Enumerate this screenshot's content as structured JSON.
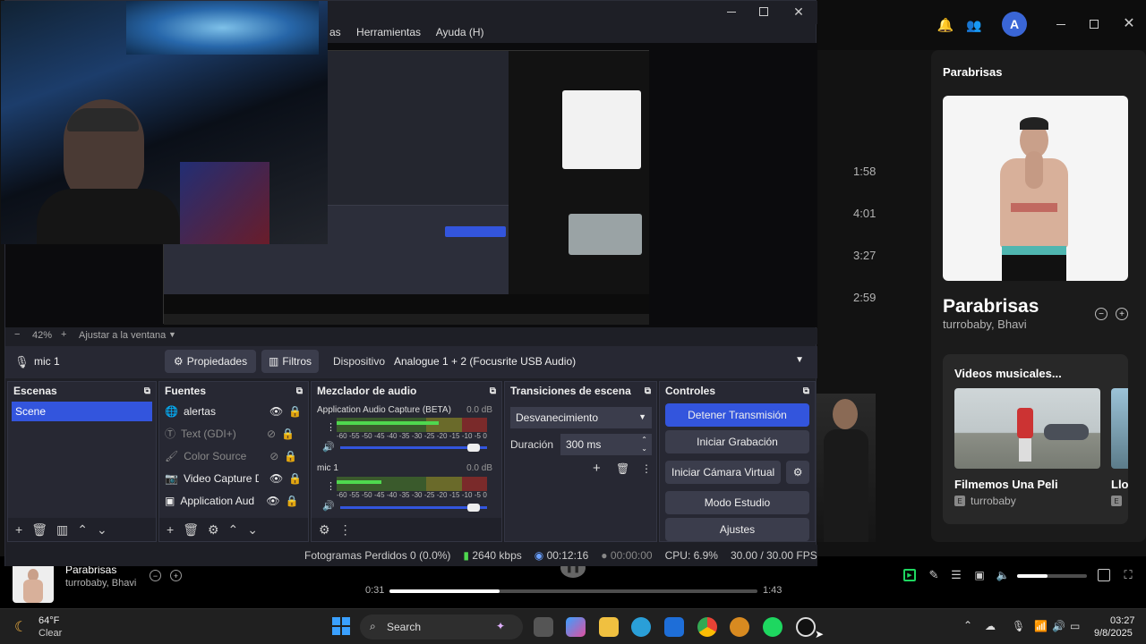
{
  "spotify": {
    "durations": [
      "1:58",
      "4:01",
      "3:27",
      "2:59"
    ],
    "panel_header": "Parabrisas",
    "track_title": "Parabrisas",
    "track_artists": "turrobaby, Bhavi",
    "videos_heading": "Videos musicales...",
    "video_title": "Filmemos Una Peli",
    "video_artist": "turrobaby",
    "video2_title_partial": "Llo",
    "user_initial": "A",
    "player": {
      "title": "Parabrisas",
      "artists": "turrobaby, Bhavi",
      "elapsed": "0:31",
      "total": "1:43",
      "progress": 0.3
    }
  },
  "obs": {
    "menu": [
      "as",
      "Herramientas",
      "Ayuda (H)"
    ],
    "zoom": "42%",
    "fit_label": "Ajustar a la ventana",
    "source_name": "mic 1",
    "properties_btn": "Propiedades",
    "filters_btn": "Filtros",
    "device_label": "Dispositivo",
    "device_value": "Analogue 1 + 2 (Focusrite USB Audio)",
    "docks": {
      "scenes": {
        "title": "Escenas",
        "items": [
          "Scene"
        ]
      },
      "sources": {
        "title": "Fuentes",
        "items": [
          {
            "name": "alertas",
            "icon": "globe-icon",
            "visible": true
          },
          {
            "name": "Text (GDI+)",
            "icon": "text-icon",
            "visible": false
          },
          {
            "name": "Color Source",
            "icon": "brush-icon",
            "visible": false
          },
          {
            "name": "Video Capture D",
            "icon": "camera-icon",
            "visible": true
          },
          {
            "name": "Application Aud",
            "icon": "app-audio-icon",
            "visible": true
          }
        ]
      },
      "mixer": {
        "title": "Mezclador de audio",
        "channels": [
          {
            "name": "Application Audio Capture (BETA)",
            "db": "0.0 dB",
            "level": 0.68,
            "fader": 0.95
          },
          {
            "name": "mic 1",
            "db": "0.0 dB",
            "level": 0.3,
            "fader": 0.95
          }
        ],
        "scale": [
          "-60",
          "-55",
          "-50",
          "-45",
          "-40",
          "-35",
          "-30",
          "-25",
          "-20",
          "-15",
          "-10",
          "-5",
          "0"
        ]
      },
      "transitions": {
        "title": "Transiciones de escena",
        "selected": "Desvanecimiento",
        "duration_label": "Duración",
        "duration_value": "300 ms"
      },
      "controls": {
        "title": "Controles",
        "stop_stream": "Detener Transmisión",
        "start_recording": "Iniciar Grabación",
        "start_virtualcam": "Iniciar Cámara Virtual",
        "studio_mode": "Modo Estudio",
        "settings": "Ajustes"
      }
    },
    "status": {
      "dropped": "Fotogramas Perdidos 0 (0.0%)",
      "bitrate": "2640 kbps",
      "stream_time": "00:12:16",
      "rec_time": "00:00:00",
      "cpu": "CPU: 6.9%",
      "fps": "30.00 / 30.00 FPS"
    }
  },
  "taskbar": {
    "weather_temp": "64°F",
    "weather_desc": "Clear",
    "search": "Search",
    "time": "03:27",
    "date": "9/8/2025"
  },
  "colors": {
    "obs_bg": "#1e1f26",
    "obs_panel": "#272833",
    "obs_accent": "#3355dd",
    "spotify_green": "#1ed760"
  }
}
